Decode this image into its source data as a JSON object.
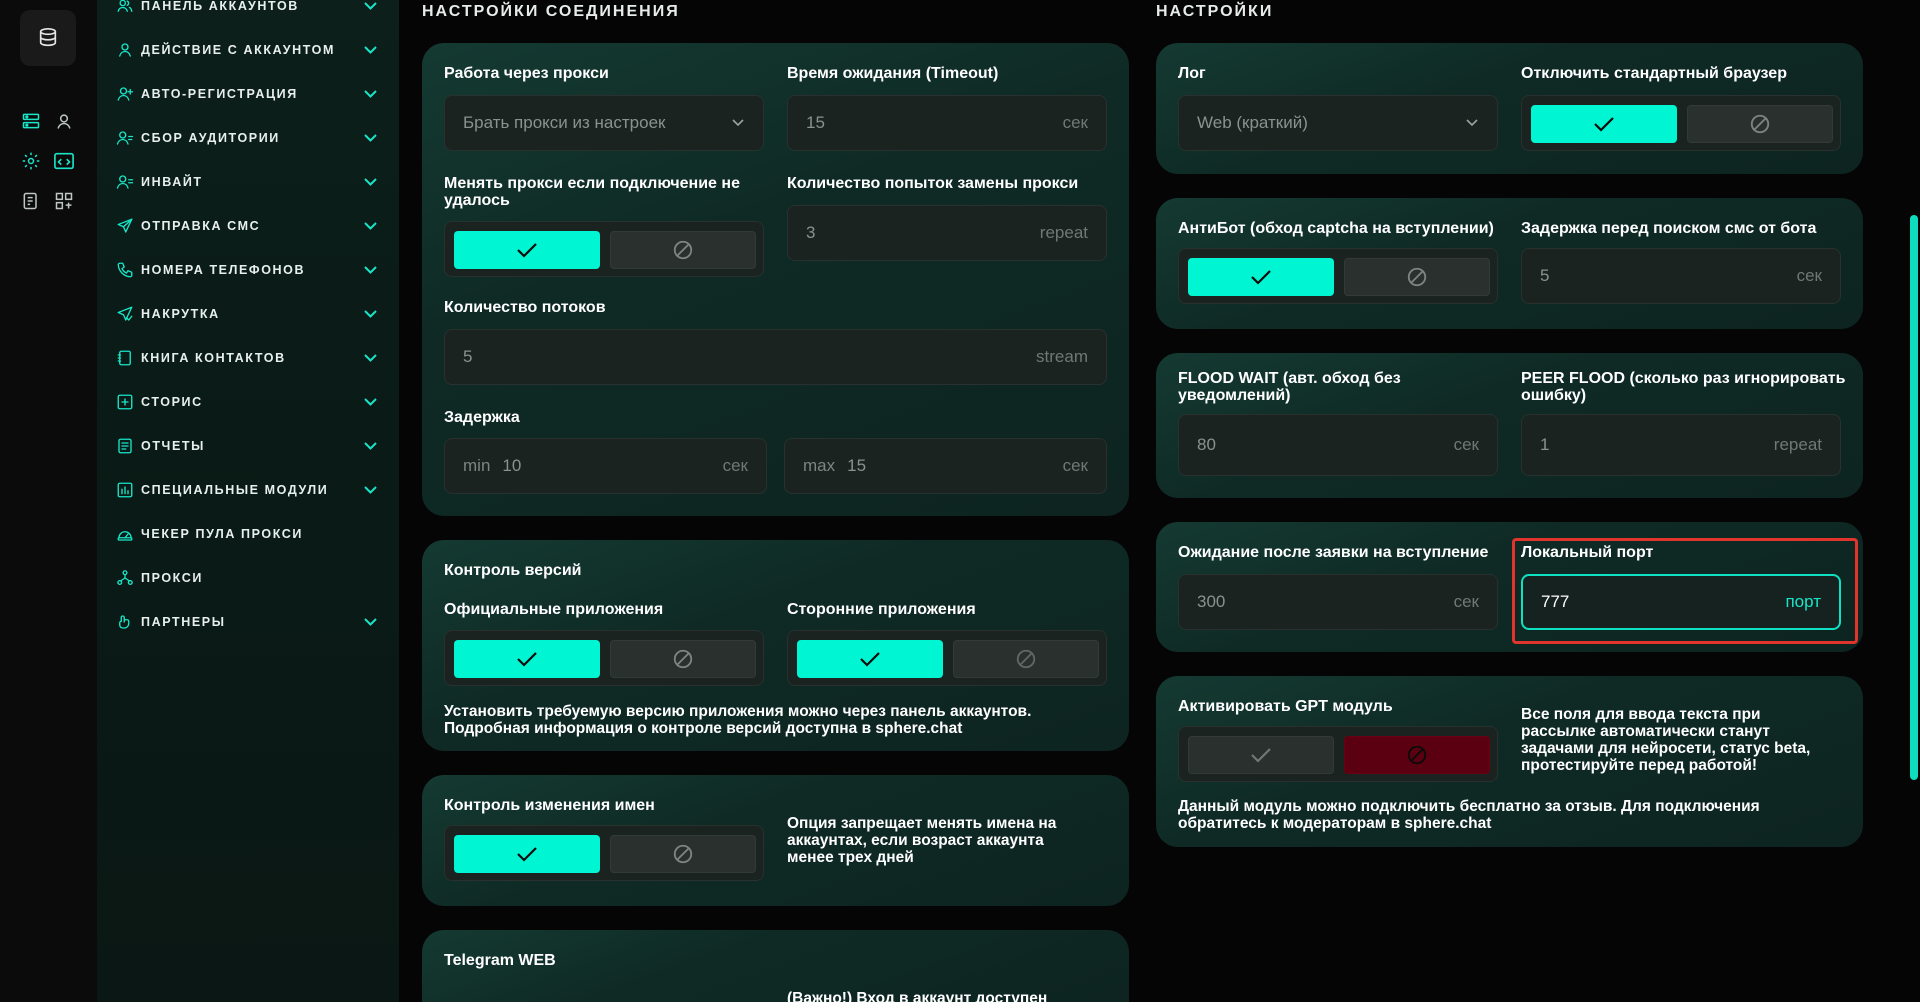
{
  "sidebar": {
    "items": [
      {
        "label": "ПАНЕЛЬ АККАУНТОВ",
        "icon": "users-icon",
        "chevron": true
      },
      {
        "label": "ДЕЙСТВИЕ С АККАУНТОМ",
        "icon": "user-icon",
        "chevron": true
      },
      {
        "label": "АВТО-РЕГИСТРАЦИЯ",
        "icon": "user-plus-icon",
        "chevron": true
      },
      {
        "label": "СБОР АУДИТОРИИ",
        "icon": "audience-icon",
        "chevron": true
      },
      {
        "label": "ИНВАЙТ",
        "icon": "invite-icon",
        "chevron": true
      },
      {
        "label": "ОТПРАВКА СМС",
        "icon": "send-icon",
        "chevron": true
      },
      {
        "label": "НОМЕРА ТЕЛЕФОНОВ",
        "icon": "phone-icon",
        "chevron": true
      },
      {
        "label": "НАКРУТКА",
        "icon": "boost-icon",
        "chevron": true
      },
      {
        "label": "КНИГА КОНТАКТОВ",
        "icon": "contacts-icon",
        "chevron": true
      },
      {
        "label": "СТОРИС",
        "icon": "story-icon",
        "chevron": true
      },
      {
        "label": "ОТЧЕТЫ",
        "icon": "report-icon",
        "chevron": true
      },
      {
        "label": "СПЕЦИАЛЬНЫЕ МОДУЛИ",
        "icon": "modules-icon",
        "chevron": true
      },
      {
        "label": "ЧЕКЕР ПУЛА ПРОКСИ",
        "icon": "gauge-icon",
        "chevron": false
      },
      {
        "label": "ПРОКСИ",
        "icon": "network-icon",
        "chevron": false
      },
      {
        "label": "ПАРТНЕРЫ",
        "icon": "handshake-icon",
        "chevron": true
      }
    ]
  },
  "connection": {
    "title": "НАСТРОЙКИ СОЕДИНЕНИЯ",
    "proxy_label": "Работа через прокси",
    "proxy_value": "Брать прокси из настроек",
    "timeout_label": "Время ожидания (Timeout)",
    "timeout_value": "15",
    "timeout_unit": "сек",
    "change_proxy_label_1": "Менять прокси если подключение не",
    "change_proxy_label_2": "удалось",
    "attempts_label": "Количество попыток замены прокси",
    "attempts_value": "3",
    "attempts_unit": "repeat",
    "threads_label": "Количество потоков",
    "threads_value": "5",
    "threads_unit": "stream",
    "delay_label": "Задержка",
    "delay_min_prefix": "min",
    "delay_min_value": "10",
    "delay_min_unit": "сек",
    "delay_max_prefix": "max",
    "delay_max_value": "15",
    "delay_max_unit": "сек"
  },
  "versions": {
    "title": "Контроль версий",
    "official_label": "Официальные приложения",
    "thirdparty_label": "Сторонние приложения",
    "note_1": "Установить требуемую версию приложения можно через панель аккаунтов.",
    "note_2": "Подробная информация о контроле версий доступна в sphere.chat"
  },
  "names": {
    "title": "Контроль изменения имен",
    "note_1": "Опция запрещает менять имена на",
    "note_2": "аккаунтах, если возраст аккаунта",
    "note_3": "менее трех дней"
  },
  "tgweb": {
    "title": "Telegram WEB",
    "note_1": "(Важно!) Вход в аккаунт доступен"
  },
  "settings": {
    "title": "НАСТРОЙКИ",
    "log_label": "Лог",
    "log_value": "Web (краткий)",
    "browser_label": "Отключить стандартный браузер",
    "antibot_label": "АнтиБот (обход captcha на вступлении)",
    "sms_delay_label": "Задержка перед поиском смс от бота",
    "sms_delay_value": "5",
    "sms_delay_unit": "сек",
    "flood_label_1": "FLOOD WAIT (авт. обход без",
    "flood_label_2": "уведомлений)",
    "flood_value": "80",
    "flood_unit": "сек",
    "peer_label_1": "PEER FLOOD (сколько раз игнорировать",
    "peer_label_2": "ошибку)",
    "peer_value": "1",
    "peer_unit": "repeat",
    "wait_label": "Ожидание после заявки на вступление",
    "wait_value": "300",
    "wait_unit": "сек",
    "port_label": "Локальный порт",
    "port_value": "777",
    "port_unit": "порт",
    "gpt_label": "Активировать GPT модуль",
    "gpt_note_1": "Все поля для ввода текста при",
    "gpt_note_2": "рассылке автоматически станут",
    "gpt_note_3": "задачами для нейросети, статус beta,",
    "gpt_note_4": "протестируйте перед работой!",
    "gpt_footer_1": "Данный модуль можно подключить бесплатно за отзыв. Для подключения",
    "gpt_footer_2": "обратитесь к модераторам в sphere.chat"
  },
  "colors": {
    "accent": "#00f5d2",
    "highlight": "#e0342c",
    "danger": "#5a0010"
  }
}
